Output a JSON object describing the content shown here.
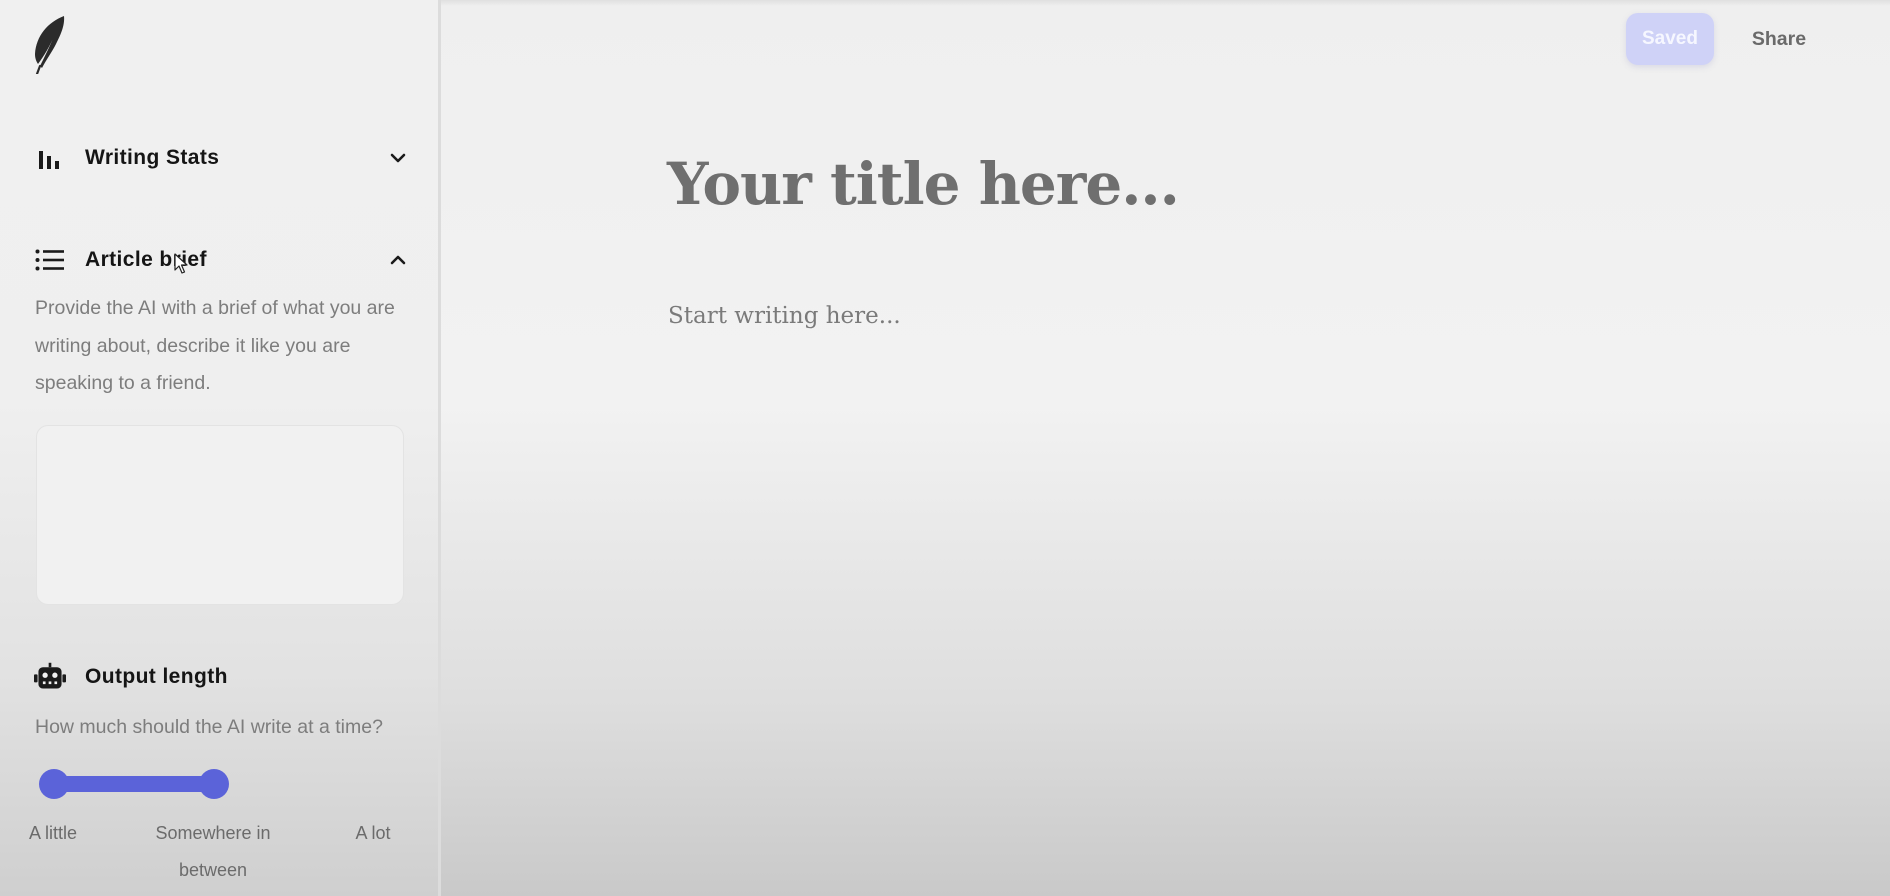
{
  "sidebar": {
    "logo_icon": "feather-icon",
    "sections": {
      "writing_stats": {
        "label": "Writing Stats",
        "icon": "bar-chart-icon",
        "expanded": false
      },
      "article_brief": {
        "label": "Article brief",
        "icon": "list-icon",
        "expanded": true,
        "description": "Provide the AI with a brief of what you are writing about, describe it like you are speaking to a friend.",
        "textarea_value": ""
      },
      "output_length": {
        "label": "Output length",
        "icon": "robot-icon",
        "description": "How much should the AI write at a time?",
        "slider": {
          "min_label": "A little",
          "mid_label": "Somewhere in between",
          "max_label": "A lot"
        }
      }
    }
  },
  "toolbar": {
    "saved_label": "Saved",
    "share_label": "Share"
  },
  "editor": {
    "title_placeholder": "Your title here...",
    "body_placeholder": "Start writing here..."
  },
  "colors": {
    "accent": "#5b63d9",
    "saved_bg": "#cfd2f7"
  }
}
